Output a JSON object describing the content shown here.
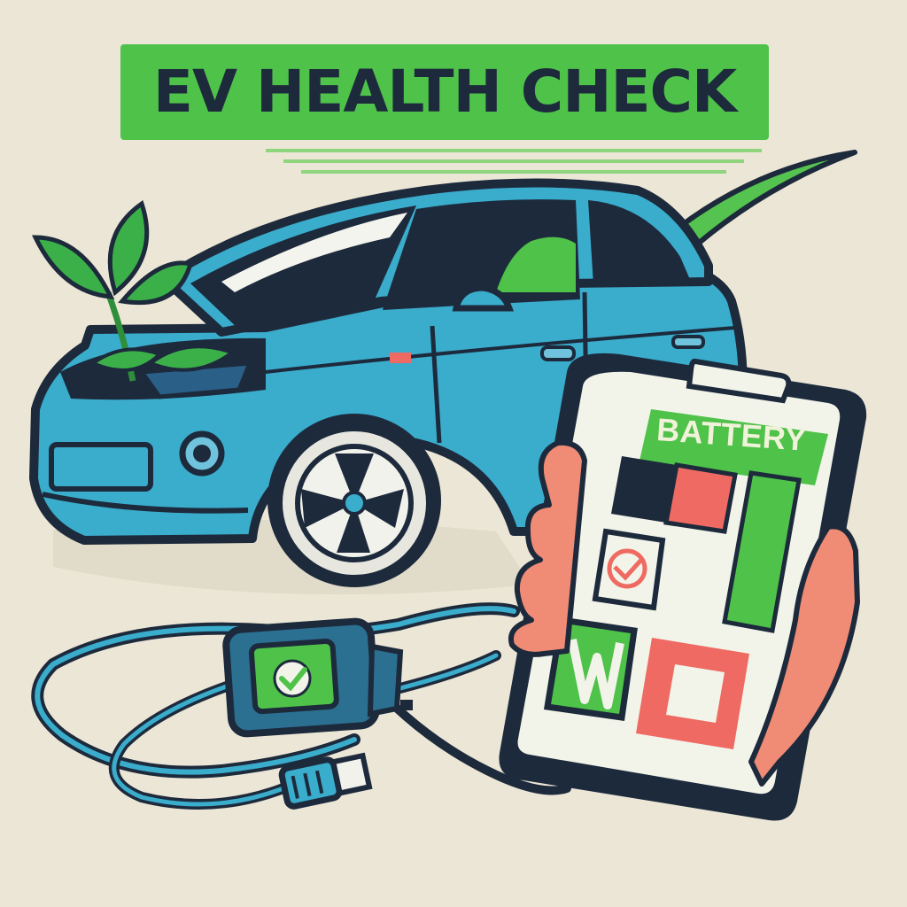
{
  "title": "EV HEALTH CHECK",
  "tablet": {
    "label": "BATTERY"
  },
  "colors": {
    "background": "#ece6d6",
    "accent_green": "#4fc24a",
    "car_blue": "#3aaccc",
    "outline": "#1d2a3c",
    "alert_red": "#ef6a62",
    "skin": "#f08b76"
  },
  "icons": [
    "leaf-icon",
    "checkmark-icon",
    "check-icon",
    "alert-icon",
    "usb-plug-icon"
  ]
}
